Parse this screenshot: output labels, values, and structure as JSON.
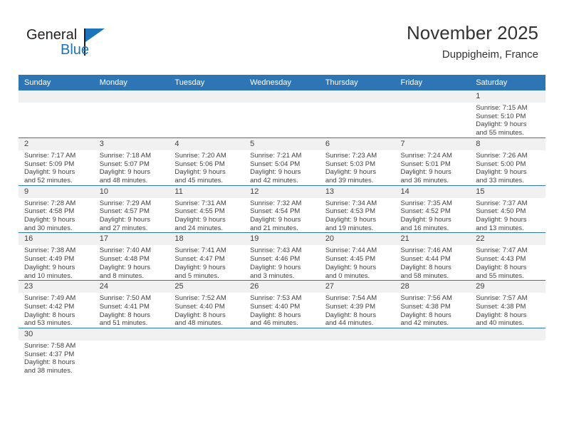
{
  "brand": {
    "name_top": "General",
    "name_bottom": "Blue",
    "accent_color": "#1b75bb"
  },
  "header": {
    "title": "November 2025",
    "subtitle": "Duppigheim, France",
    "header_bg_color": "#2e75b6",
    "date_band_color": "#f1f1f1"
  },
  "weekdays": [
    "Sunday",
    "Monday",
    "Tuesday",
    "Wednesday",
    "Thursday",
    "Friday",
    "Saturday"
  ],
  "weeks": [
    [
      {
        "date": "",
        "lines": []
      },
      {
        "date": "",
        "lines": []
      },
      {
        "date": "",
        "lines": []
      },
      {
        "date": "",
        "lines": []
      },
      {
        "date": "",
        "lines": []
      },
      {
        "date": "",
        "lines": []
      },
      {
        "date": "1",
        "lines": [
          "Sunrise: 7:15 AM",
          "Sunset: 5:10 PM",
          "Daylight: 9 hours",
          "and 55 minutes."
        ]
      }
    ],
    [
      {
        "date": "2",
        "lines": [
          "Sunrise: 7:17 AM",
          "Sunset: 5:09 PM",
          "Daylight: 9 hours",
          "and 52 minutes."
        ]
      },
      {
        "date": "3",
        "lines": [
          "Sunrise: 7:18 AM",
          "Sunset: 5:07 PM",
          "Daylight: 9 hours",
          "and 48 minutes."
        ]
      },
      {
        "date": "4",
        "lines": [
          "Sunrise: 7:20 AM",
          "Sunset: 5:06 PM",
          "Daylight: 9 hours",
          "and 45 minutes."
        ]
      },
      {
        "date": "5",
        "lines": [
          "Sunrise: 7:21 AM",
          "Sunset: 5:04 PM",
          "Daylight: 9 hours",
          "and 42 minutes."
        ]
      },
      {
        "date": "6",
        "lines": [
          "Sunrise: 7:23 AM",
          "Sunset: 5:03 PM",
          "Daylight: 9 hours",
          "and 39 minutes."
        ]
      },
      {
        "date": "7",
        "lines": [
          "Sunrise: 7:24 AM",
          "Sunset: 5:01 PM",
          "Daylight: 9 hours",
          "and 36 minutes."
        ]
      },
      {
        "date": "8",
        "lines": [
          "Sunrise: 7:26 AM",
          "Sunset: 5:00 PM",
          "Daylight: 9 hours",
          "and 33 minutes."
        ]
      }
    ],
    [
      {
        "date": "9",
        "lines": [
          "Sunrise: 7:28 AM",
          "Sunset: 4:58 PM",
          "Daylight: 9 hours",
          "and 30 minutes."
        ]
      },
      {
        "date": "10",
        "lines": [
          "Sunrise: 7:29 AM",
          "Sunset: 4:57 PM",
          "Daylight: 9 hours",
          "and 27 minutes."
        ]
      },
      {
        "date": "11",
        "lines": [
          "Sunrise: 7:31 AM",
          "Sunset: 4:55 PM",
          "Daylight: 9 hours",
          "and 24 minutes."
        ]
      },
      {
        "date": "12",
        "lines": [
          "Sunrise: 7:32 AM",
          "Sunset: 4:54 PM",
          "Daylight: 9 hours",
          "and 21 minutes."
        ]
      },
      {
        "date": "13",
        "lines": [
          "Sunrise: 7:34 AM",
          "Sunset: 4:53 PM",
          "Daylight: 9 hours",
          "and 19 minutes."
        ]
      },
      {
        "date": "14",
        "lines": [
          "Sunrise: 7:35 AM",
          "Sunset: 4:52 PM",
          "Daylight: 9 hours",
          "and 16 minutes."
        ]
      },
      {
        "date": "15",
        "lines": [
          "Sunrise: 7:37 AM",
          "Sunset: 4:50 PM",
          "Daylight: 9 hours",
          "and 13 minutes."
        ]
      }
    ],
    [
      {
        "date": "16",
        "lines": [
          "Sunrise: 7:38 AM",
          "Sunset: 4:49 PM",
          "Daylight: 9 hours",
          "and 10 minutes."
        ]
      },
      {
        "date": "17",
        "lines": [
          "Sunrise: 7:40 AM",
          "Sunset: 4:48 PM",
          "Daylight: 9 hours",
          "and 8 minutes."
        ]
      },
      {
        "date": "18",
        "lines": [
          "Sunrise: 7:41 AM",
          "Sunset: 4:47 PM",
          "Daylight: 9 hours",
          "and 5 minutes."
        ]
      },
      {
        "date": "19",
        "lines": [
          "Sunrise: 7:43 AM",
          "Sunset: 4:46 PM",
          "Daylight: 9 hours",
          "and 3 minutes."
        ]
      },
      {
        "date": "20",
        "lines": [
          "Sunrise: 7:44 AM",
          "Sunset: 4:45 PM",
          "Daylight: 9 hours",
          "and 0 minutes."
        ]
      },
      {
        "date": "21",
        "lines": [
          "Sunrise: 7:46 AM",
          "Sunset: 4:44 PM",
          "Daylight: 8 hours",
          "and 58 minutes."
        ]
      },
      {
        "date": "22",
        "lines": [
          "Sunrise: 7:47 AM",
          "Sunset: 4:43 PM",
          "Daylight: 8 hours",
          "and 55 minutes."
        ]
      }
    ],
    [
      {
        "date": "23",
        "lines": [
          "Sunrise: 7:49 AM",
          "Sunset: 4:42 PM",
          "Daylight: 8 hours",
          "and 53 minutes."
        ]
      },
      {
        "date": "24",
        "lines": [
          "Sunrise: 7:50 AM",
          "Sunset: 4:41 PM",
          "Daylight: 8 hours",
          "and 51 minutes."
        ]
      },
      {
        "date": "25",
        "lines": [
          "Sunrise: 7:52 AM",
          "Sunset: 4:40 PM",
          "Daylight: 8 hours",
          "and 48 minutes."
        ]
      },
      {
        "date": "26",
        "lines": [
          "Sunrise: 7:53 AM",
          "Sunset: 4:40 PM",
          "Daylight: 8 hours",
          "and 46 minutes."
        ]
      },
      {
        "date": "27",
        "lines": [
          "Sunrise: 7:54 AM",
          "Sunset: 4:39 PM",
          "Daylight: 8 hours",
          "and 44 minutes."
        ]
      },
      {
        "date": "28",
        "lines": [
          "Sunrise: 7:56 AM",
          "Sunset: 4:38 PM",
          "Daylight: 8 hours",
          "and 42 minutes."
        ]
      },
      {
        "date": "29",
        "lines": [
          "Sunrise: 7:57 AM",
          "Sunset: 4:38 PM",
          "Daylight: 8 hours",
          "and 40 minutes."
        ]
      }
    ],
    [
      {
        "date": "30",
        "lines": [
          "Sunrise: 7:58 AM",
          "Sunset: 4:37 PM",
          "Daylight: 8 hours",
          "and 38 minutes."
        ]
      },
      {
        "date": "",
        "lines": []
      },
      {
        "date": "",
        "lines": []
      },
      {
        "date": "",
        "lines": []
      },
      {
        "date": "",
        "lines": []
      },
      {
        "date": "",
        "lines": []
      },
      {
        "date": "",
        "lines": []
      }
    ]
  ]
}
